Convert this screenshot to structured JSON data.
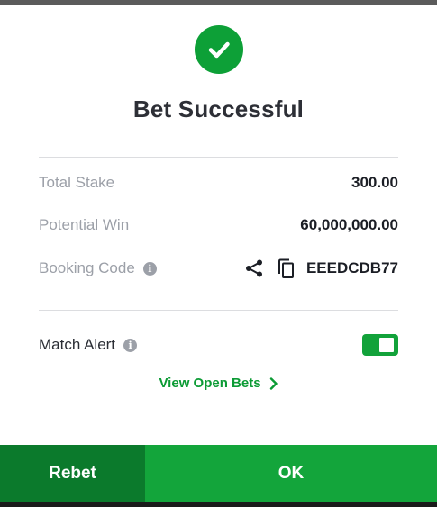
{
  "dialog": {
    "title": "Bet Successful",
    "status_icon": "check-circle-icon",
    "accent_color": "#0da037"
  },
  "summary": {
    "total_stake_label": "Total Stake",
    "total_stake_value": "300.00",
    "potential_win_label": "Potential Win",
    "potential_win_value": "60,000,000.00",
    "booking_code_label": "Booking Code",
    "booking_code_value": "EEEDCDB77"
  },
  "match_alert": {
    "label": "Match Alert",
    "enabled": true
  },
  "links": {
    "view_open_bets": "View Open Bets"
  },
  "buttons": {
    "rebet": "Rebet",
    "ok": "OK"
  },
  "colors": {
    "primary_green": "#13a53b",
    "dark_green": "#0b7a2c",
    "label_gray": "#9ca0a8"
  }
}
